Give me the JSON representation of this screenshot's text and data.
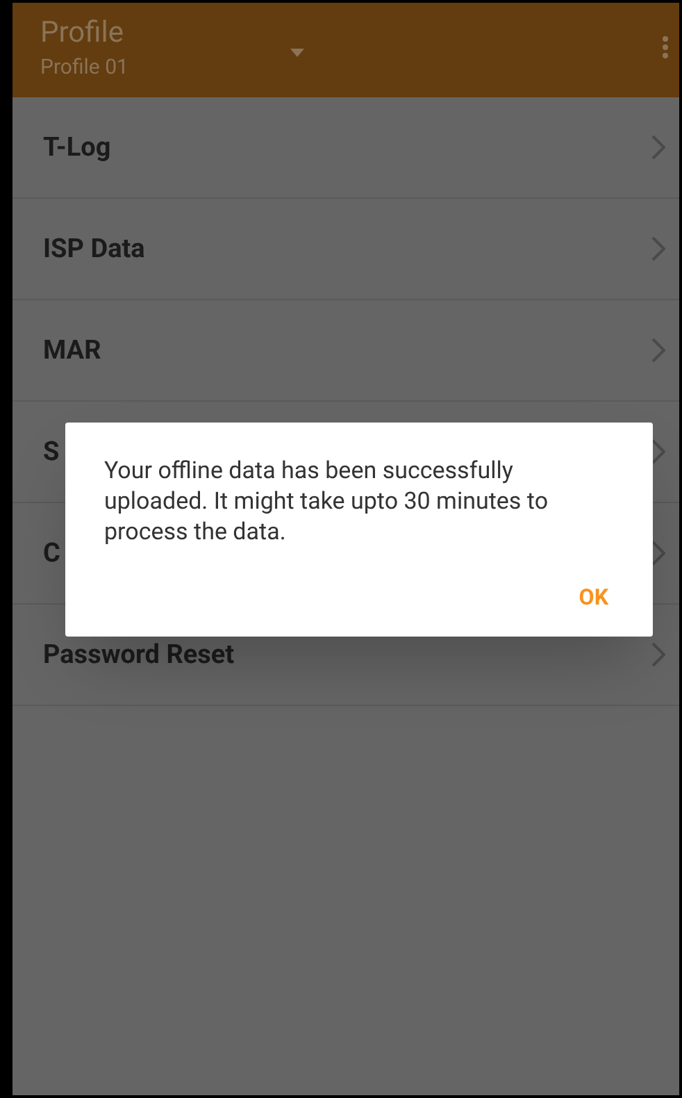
{
  "app_bar": {
    "title": "Profile",
    "subtitle": "Profile 01"
  },
  "menu_items": [
    {
      "label": "T-Log"
    },
    {
      "label": "ISP Data"
    },
    {
      "label": "MAR"
    },
    {
      "label": "S"
    },
    {
      "label": "C"
    },
    {
      "label": "Password Reset"
    }
  ],
  "dialog": {
    "message": "Your offline data has been successfully uploaded. It might take upto 30 minutes to process the data.",
    "button": "OK"
  }
}
